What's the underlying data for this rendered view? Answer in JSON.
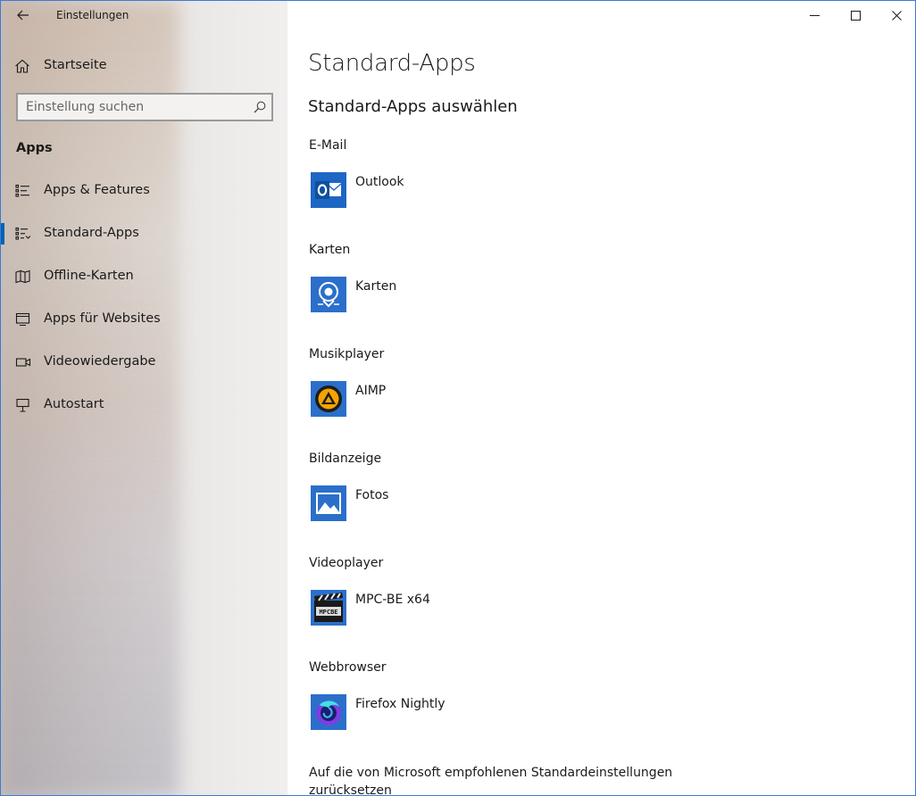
{
  "window": {
    "title": "Einstellungen"
  },
  "sidebar": {
    "home_label": "Startseite",
    "search_placeholder": "Einstellung suchen",
    "section_heading": "Apps",
    "items": [
      {
        "label": "Apps & Features",
        "icon": "apps-features-icon"
      },
      {
        "label": "Standard-Apps",
        "icon": "default-apps-icon",
        "active": true
      },
      {
        "label": "Offline-Karten",
        "icon": "offline-maps-icon"
      },
      {
        "label": "Apps für Websites",
        "icon": "apps-websites-icon"
      },
      {
        "label": "Videowiedergabe",
        "icon": "video-playback-icon"
      },
      {
        "label": "Autostart",
        "icon": "startup-icon"
      }
    ]
  },
  "main": {
    "title": "Standard-Apps",
    "subtitle": "Standard-Apps auswählen",
    "categories": [
      {
        "label": "E-Mail",
        "app": "Outlook",
        "icon": "outlook-icon"
      },
      {
        "label": "Karten",
        "app": "Karten",
        "icon": "maps-icon"
      },
      {
        "label": "Musikplayer",
        "app": "AIMP",
        "icon": "aimp-icon"
      },
      {
        "label": "Bildanzeige",
        "app": "Fotos",
        "icon": "photos-icon"
      },
      {
        "label": "Videoplayer",
        "app": "MPC-BE x64",
        "icon": "mpc-be-icon"
      },
      {
        "label": "Webbrowser",
        "app": "Firefox Nightly",
        "icon": "firefox-nightly-icon"
      }
    ],
    "reset_text": "Auf die von Microsoft empfohlenen Standardeinstellungen zurücksetzen"
  },
  "colors": {
    "accent": "#0063b1",
    "app_tile": "#2b6fcb"
  }
}
